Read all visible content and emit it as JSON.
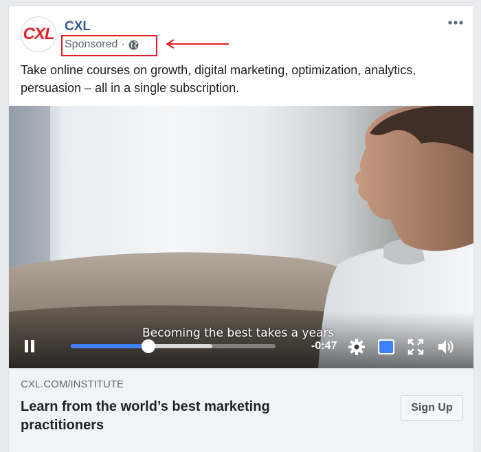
{
  "post": {
    "page_name": "CXL",
    "avatar_text": "CXL",
    "sponsored_label": "Sponsored",
    "separator": "·",
    "audience_icon": "globe-icon",
    "more_icon": "more-options-icon",
    "text": "Take online courses on growth, digital marketing, optimization, analytics, persuasion – all in a single subscription."
  },
  "annotation": {
    "highlight_color": "#e41e26",
    "arrow_icon": "left-arrow-icon"
  },
  "video": {
    "caption": "Becoming the best takes a years",
    "time_remaining": "-0:47",
    "progress_played": 0.38,
    "progress_buffered": 0.69,
    "controls": {
      "pause_icon": "pause-icon",
      "settings_icon": "gear-icon",
      "pip_icon": "picture-in-picture-icon",
      "fullscreen_icon": "fullscreen-icon",
      "volume_icon": "volume-icon"
    }
  },
  "link": {
    "domain": "CXL.COM/INSTITUTE",
    "title": "Learn from the world’s best marketing practitioners",
    "cta_label": "Sign Up"
  },
  "colors": {
    "page_name": "#385898",
    "progress": "#4080ff",
    "brand_red": "#e0232b"
  }
}
